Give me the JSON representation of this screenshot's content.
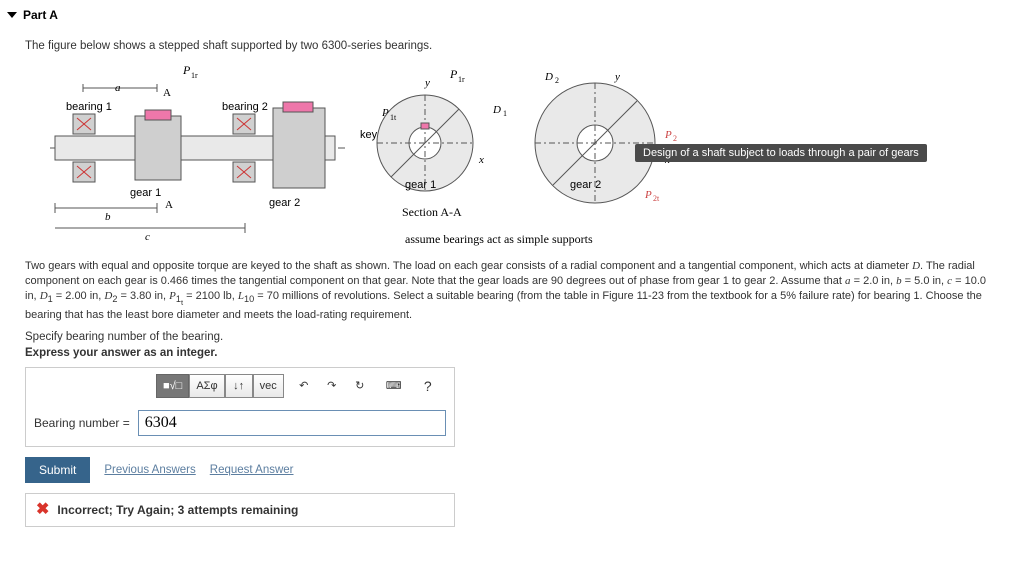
{
  "part": {
    "label": "Part A"
  },
  "intro": "The figure below shows a stepped shaft supported by two 6300-series bearings.",
  "figure_labels": {
    "bearing1": "bearing 1",
    "bearing2": "bearing 2",
    "gear1": "gear 1",
    "gear2": "gear 2",
    "key": "key",
    "sectionAA": "Section A-A",
    "gear1_circle": "gear 1",
    "gear2_circle": "gear 2",
    "assume": "assume bearings act as simple supports",
    "a": "a",
    "b": "b",
    "c": "c",
    "A1": "A",
    "A2": "A",
    "P1r_left": "P",
    "P1r_mid": "P",
    "P1t": "P",
    "D1": "D",
    "D2": "D",
    "P2": "P",
    "P2t": "P",
    "x1": "x",
    "y1": "y",
    "x2": "x",
    "y2": "y"
  },
  "tooltip": "Design of a shaft subject to loads through a pair of gears",
  "problem_html": "Two gears with equal and opposite torque are keyed to the shaft as shown. The load on each gear consists of a radial component and a tangential component, which acts at diameter <span class='serif-i'>D</span>. The radial component on each gear is 0.466 times the tangential component on that gear. Note that the gear loads are 90 degrees out of phase from gear 1 to gear 2. Assume that <span class='serif-i'>a</span> = 2.0 in, <span class='serif-i'>b</span> = 5.0 in, <span class='serif-i'>c</span> = 10.0 in, <span class='serif-i'>D</span><sub>1</sub> = 2.00 in, <span class='serif-i'>D</span><sub>2</sub> = 3.80 in, <span class='serif-i'>P</span><sub>1<sub>t</sub></sub> = 2100 lb, <span class='serif-i'>L</span><sub>10</sub> = 70 millions of revolutions. Select a suitable bearing (from the table in Figure 11-23 from the textbook for a 5% failure rate) for bearing 1. Choose the bearing that has the least bore diameter and meets the load-rating requirement.",
  "clause1": "Specify bearing number of the bearing.",
  "clause2": "Express your answer as an integer.",
  "toolbar": {
    "templ": "■√□",
    "greek": "ΑΣφ",
    "updown": "↓↑",
    "vec": "vec",
    "undo": "↶",
    "redo": "↷",
    "reset": "↻",
    "kbd": "⌨",
    "help": "?"
  },
  "answer": {
    "prefix": "Bearing number =",
    "value": "6304"
  },
  "actions": {
    "submit": "Submit",
    "previous": "Previous Answers",
    "request": "Request Answer"
  },
  "feedback": "Incorrect; Try Again; 3 attempts remaining"
}
